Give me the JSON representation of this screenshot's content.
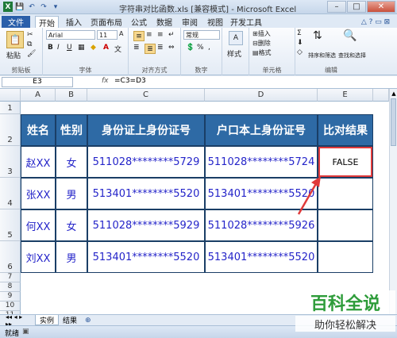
{
  "window": {
    "title": "字符串对比函数.xls [兼容模式] - Microsoft Excel",
    "controls": [
      "–",
      "□",
      "✕"
    ]
  },
  "ribbon_tabs": [
    "文件",
    "开始",
    "插入",
    "页面布局",
    "公式",
    "数据",
    "审阅",
    "视图",
    "开发工具"
  ],
  "ribbon": {
    "clipboard": {
      "paste_label": "粘贴",
      "group_label": "剪贴板"
    },
    "font": {
      "font_name": "Arial",
      "font_size": "11",
      "group_label": "字体",
      "bold": "B",
      "italic": "I",
      "underline": "U"
    },
    "alignment": {
      "group_label": "对齐方式"
    },
    "number": {
      "format": "常规",
      "group_label": "数字"
    },
    "styles": {
      "label": "样式"
    },
    "cells": {
      "insert": "插入",
      "delete": "删除",
      "format": "格式",
      "group_label": "单元格"
    },
    "editing": {
      "sort_filter": "排序和筛选",
      "find_select": "查找和选择",
      "group_label": "编辑"
    }
  },
  "formula_bar": {
    "name_box": "E3",
    "fx": "fx",
    "formula": "=C3=D3"
  },
  "columns": [
    "A",
    "B",
    "C",
    "D",
    "E"
  ],
  "rows": [
    "1",
    "2",
    "3",
    "4",
    "5",
    "6",
    "7",
    "8",
    "9",
    "10",
    "11"
  ],
  "table": {
    "headers": [
      "姓名",
      "性别",
      "身份证上身份证号",
      "户口本上身份证号",
      "比对结果"
    ],
    "rows": [
      [
        "赵XX",
        "女",
        "511028********5729",
        "511028********5724",
        "FALSE"
      ],
      [
        "张XX",
        "男",
        "513401********5520",
        "513401********5520",
        ""
      ],
      [
        "何XX",
        "女",
        "511028********5929",
        "511028********5926",
        ""
      ],
      [
        "刘XX",
        "男",
        "513401********5520",
        "513401********5520",
        ""
      ]
    ]
  },
  "sheets": [
    "实例",
    "结果"
  ],
  "status": {
    "ready": "就绪"
  },
  "watermark": {
    "line1": "百科全说",
    "line2": "助你轻松解决"
  },
  "colors": {
    "header_bg": "#2e6aa5",
    "data_text": "#2424c9",
    "highlight": "#e03a3a",
    "file_tab": "#2a5faa"
  }
}
